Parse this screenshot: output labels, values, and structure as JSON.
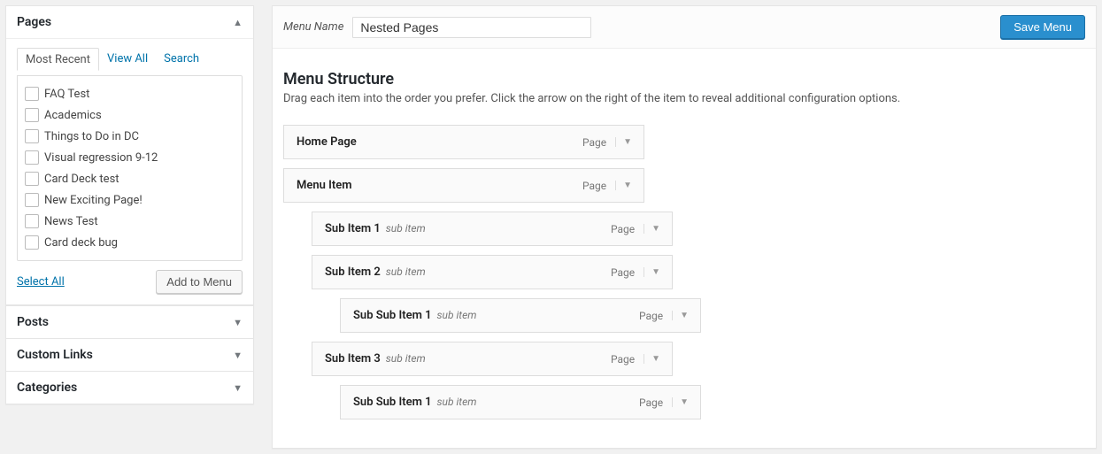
{
  "sidebar": {
    "pages_box": {
      "title": "Pages",
      "tabs": {
        "most_recent": "Most Recent",
        "view_all": "View All",
        "search": "Search"
      },
      "items": [
        "FAQ Test",
        "Academics",
        "Things to Do in DC",
        "Visual regression 9-12",
        "Card Deck test",
        "New Exciting Page!",
        "News Test",
        "Card deck bug"
      ],
      "select_all": "Select All",
      "add_to_menu": "Add to Menu"
    },
    "closed_boxes": [
      "Posts",
      "Custom Links",
      "Categories"
    ]
  },
  "main": {
    "menu_name_label": "Menu Name",
    "menu_name_value": "Nested Pages",
    "save_button": "Save Menu",
    "structure_title": "Menu Structure",
    "structure_desc": "Drag each item into the order you prefer. Click the arrow on the right of the item to reveal additional configuration options.",
    "type_label": "Page",
    "sub_label": "sub item",
    "items": [
      {
        "title": "Home Page",
        "indent": 0,
        "sub": false
      },
      {
        "title": "Menu Item",
        "indent": 0,
        "sub": false
      },
      {
        "title": "Sub Item 1",
        "indent": 1,
        "sub": true
      },
      {
        "title": "Sub Item 2",
        "indent": 1,
        "sub": true
      },
      {
        "title": "Sub Sub Item 1",
        "indent": 2,
        "sub": true
      },
      {
        "title": "Sub Item 3",
        "indent": 1,
        "sub": true
      },
      {
        "title": "Sub Sub Item 1",
        "indent": 2,
        "sub": true
      }
    ]
  }
}
